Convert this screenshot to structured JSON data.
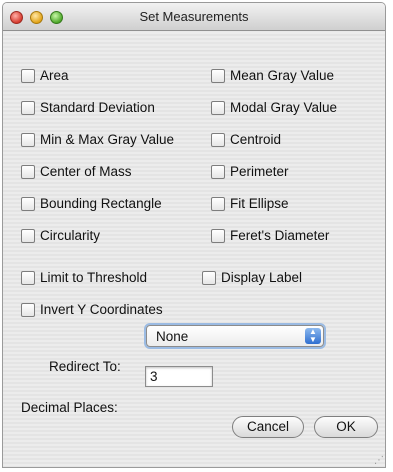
{
  "window": {
    "title": "Set Measurements"
  },
  "measurements": {
    "left": [
      {
        "label": "Area"
      },
      {
        "label": "Standard Deviation"
      },
      {
        "label": "Min & Max Gray Value"
      },
      {
        "label": "Center of Mass"
      },
      {
        "label": "Bounding Rectangle"
      },
      {
        "label": "Circularity"
      }
    ],
    "right": [
      {
        "label": "Mean Gray Value"
      },
      {
        "label": "Modal Gray Value"
      },
      {
        "label": "Centroid"
      },
      {
        "label": "Perimeter"
      },
      {
        "label": "Fit Ellipse"
      },
      {
        "label": "Feret's Diameter"
      }
    ]
  },
  "options": {
    "limit_to_threshold": "Limit to Threshold",
    "display_label": "Display Label",
    "invert_y": "Invert Y Coordinates"
  },
  "redirect": {
    "label": "Redirect To:",
    "value": "None"
  },
  "decimal": {
    "label": "Decimal Places:",
    "value": "3"
  },
  "buttons": {
    "cancel": "Cancel",
    "ok": "OK"
  }
}
